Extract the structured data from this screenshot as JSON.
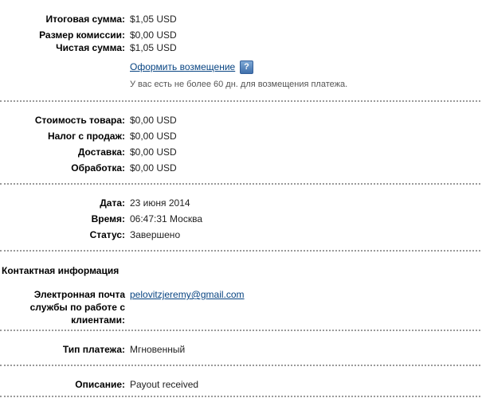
{
  "totals": [
    {
      "label": "Итоговая сумма:",
      "value": "$1,05 USD"
    },
    {
      "label": "Размер комиссии:",
      "value": "$0,00 USD"
    },
    {
      "label": "Чистая сумма:",
      "value": "$1,05 USD"
    }
  ],
  "refund": {
    "link_label": "Оформить возмещение",
    "help_glyph": "?",
    "help_icon": "help-icon",
    "note": "У вас есть не более 60 дн. для возмещения платежа."
  },
  "costs": [
    {
      "label": "Стоимость товара:",
      "value": "$0,00 USD"
    },
    {
      "label": "Налог с продаж:",
      "value": "$0,00 USD"
    },
    {
      "label": "Доставка:",
      "value": "$0,00 USD"
    },
    {
      "label": "Обработка:",
      "value": "$0,00 USD"
    }
  ],
  "status_info": [
    {
      "label": "Дата:",
      "value": "23 июня 2014"
    },
    {
      "label": "Время:",
      "value": "06:47:31 Москва"
    },
    {
      "label": "Статус:",
      "value": "Завершено"
    }
  ],
  "contact": {
    "title": "Контактная информация",
    "email_label": "Электронная почта службы по работе с клиентами:",
    "email_value": "pelovitzjeremy@gmail.com"
  },
  "payment_type": {
    "label": "Тип платежа:",
    "value": "Мгновенный"
  },
  "description": {
    "label": "Описание:",
    "value": "Payout received"
  },
  "colors": {
    "link": "#084482",
    "divider": "#9a9a9a",
    "help_icon": "#3f6fab"
  }
}
